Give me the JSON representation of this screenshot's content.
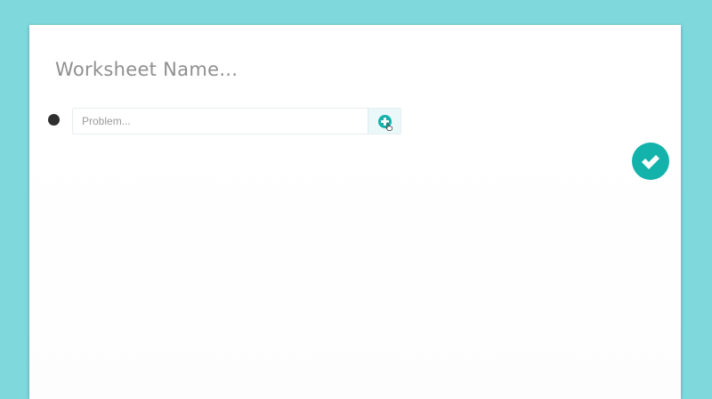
{
  "worksheet": {
    "name_placeholder": "Worksheet Name..."
  },
  "problem": {
    "placeholder": "Problem...",
    "value": ""
  },
  "icons": {
    "bullet": "bullet-dot-icon",
    "add": "plus-circle-icon",
    "cursor": "hand-pointer-icon",
    "done": "checkmark-icon"
  },
  "colors": {
    "background": "#7fd8dc",
    "accent": "#13b3ab",
    "title_text": "#8f8f8f"
  }
}
